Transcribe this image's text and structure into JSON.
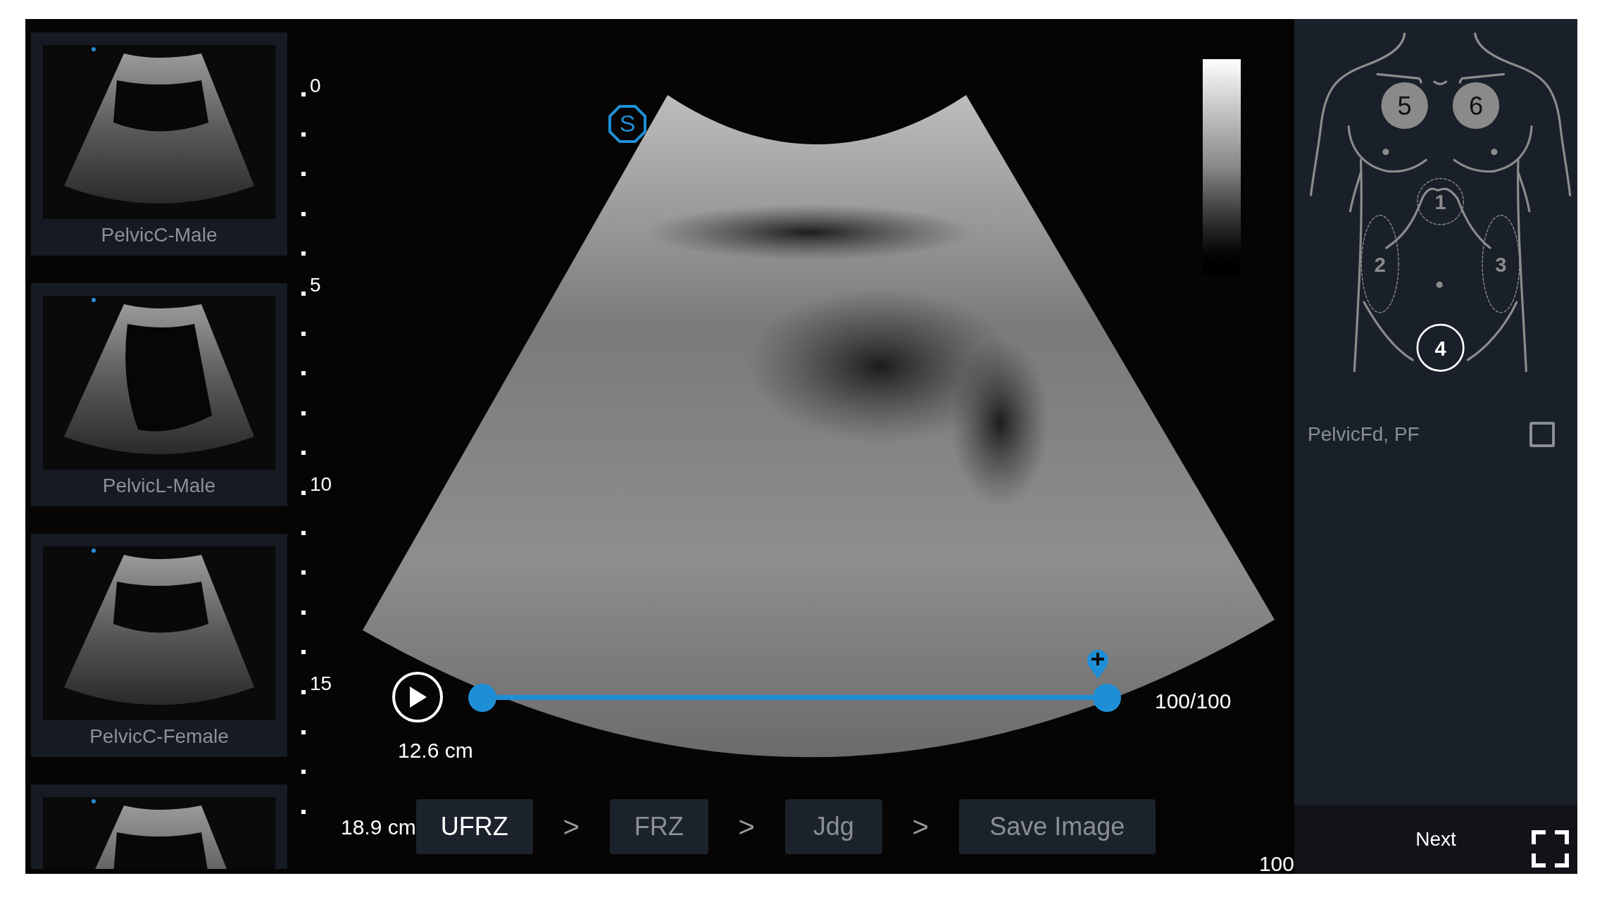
{
  "thumbnails": [
    {
      "label": "PelvicC-Male"
    },
    {
      "label": "PelvicL-Male"
    },
    {
      "label": "PelvicC-Female"
    }
  ],
  "partial_thumbnail": true,
  "depth_scale": {
    "labels": [
      "0",
      "5",
      "10",
      "15"
    ]
  },
  "orientation_marker": "S",
  "cine": {
    "measurement": "12.6 cm",
    "level": 1,
    "frame_counter": "100/100"
  },
  "depth": "18.9 cm",
  "steps": [
    {
      "label": "UFRZ",
      "selected": true
    },
    {
      "label": "FRZ",
      "selected": false
    },
    {
      "label": "Jdg",
      "selected": false
    },
    {
      "label": "Save Image",
      "selected": false
    }
  ],
  "separators": [
    ">",
    ">",
    ">"
  ],
  "corner_value": "100",
  "body_map": {
    "zones": [
      {
        "label": "5",
        "completed": true,
        "selected": false
      },
      {
        "label": "6",
        "completed": true,
        "selected": false
      },
      {
        "label": "1",
        "completed": false,
        "selected": false
      },
      {
        "label": "2",
        "completed": false,
        "selected": false
      },
      {
        "label": "3",
        "completed": false,
        "selected": false
      },
      {
        "label": "4",
        "completed": false,
        "selected": true
      }
    ]
  },
  "options": [
    {
      "label": "PelvicFd, PF",
      "checked": false
    }
  ],
  "next_button": "Next"
}
